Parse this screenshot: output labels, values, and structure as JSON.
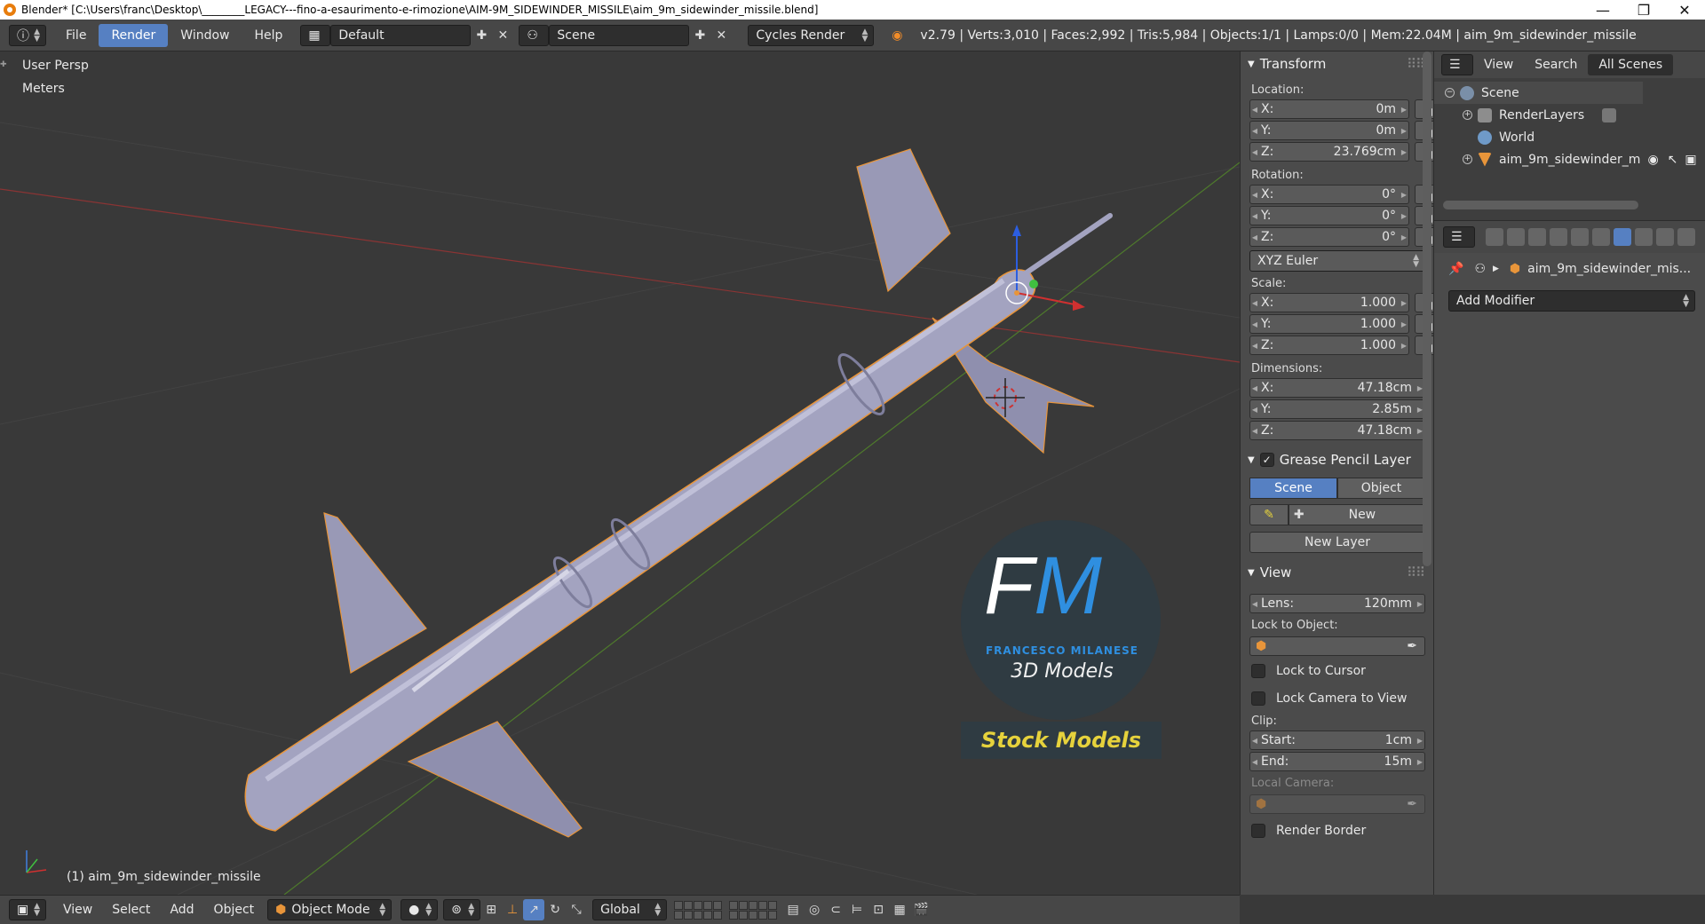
{
  "window": {
    "title": "Blender* [C:\\Users\\franc\\Desktop\\________LEGACY---fino-a-esaurimento-e-rimozione\\AIM-9M_SIDEWINDER_MISSILE\\aim_9m_sidewinder_missile.blend]",
    "minimize": "—",
    "maximize": "❐",
    "close": "✕"
  },
  "menubar": {
    "info_icon": "ⓘ",
    "file": "File",
    "render": "Render",
    "window": "Window",
    "help": "Help",
    "layout": "Default",
    "scene": "Scene",
    "engine": "Cycles Render",
    "stats": "v2.79 | Verts:3,010 | Faces:2,992 | Tris:5,984 | Objects:1/1 | Lamps:0/0 | Mem:22.04M | aim_9m_sidewinder_missile"
  },
  "viewport": {
    "view_name": "User Persp",
    "units": "Meters",
    "active_object": "(1) aim_9m_sidewinder_missile",
    "watermark": {
      "initials_f": "F",
      "initials_m": "M",
      "author": "FRANCESCO MILANESE",
      "tagline": "3D Models",
      "banner": "Stock Models"
    }
  },
  "transform": {
    "title": "Transform",
    "location_label": "Location:",
    "location": [
      {
        "axis": "X:",
        "value": "0m"
      },
      {
        "axis": "Y:",
        "value": "0m"
      },
      {
        "axis": "Z:",
        "value": "23.769cm"
      }
    ],
    "rotation_label": "Rotation:",
    "rotation": [
      {
        "axis": "X:",
        "value": "0°"
      },
      {
        "axis": "Y:",
        "value": "0°"
      },
      {
        "axis": "Z:",
        "value": "0°"
      }
    ],
    "rotation_mode": "XYZ Euler",
    "scale_label": "Scale:",
    "scale": [
      {
        "axis": "X:",
        "value": "1.000"
      },
      {
        "axis": "Y:",
        "value": "1.000"
      },
      {
        "axis": "Z:",
        "value": "1.000"
      }
    ],
    "dimensions_label": "Dimensions:",
    "dimensions": [
      {
        "axis": "X:",
        "value": "47.18cm"
      },
      {
        "axis": "Y:",
        "value": "2.85m"
      },
      {
        "axis": "Z:",
        "value": "47.18cm"
      }
    ]
  },
  "grease_pencil": {
    "title": "Grease Pencil Layer",
    "scene_tab": "Scene",
    "object_tab": "Object",
    "new_label": "New",
    "new_layer_label": "New Layer"
  },
  "view_panel": {
    "title": "View",
    "lens_label": "Lens:",
    "lens_value": "120mm",
    "lock_object_label": "Lock to Object:",
    "lock_cursor": "Lock to Cursor",
    "lock_camera": "Lock Camera to View",
    "clip_label": "Clip:",
    "clip_start_label": "Start:",
    "clip_start_value": "1cm",
    "clip_end_label": "End:",
    "clip_end_value": "15m",
    "local_camera_label": "Local Camera:",
    "render_border": "Render Border"
  },
  "outliner": {
    "view": "View",
    "search": "Search",
    "scenes": "All Scenes",
    "items": [
      {
        "label": "Scene"
      },
      {
        "label": "RenderLayers"
      },
      {
        "label": "World"
      },
      {
        "label": "aim_9m_sidewinder_m"
      }
    ]
  },
  "properties": {
    "object_name": "aim_9m_sidewinder_mis...",
    "add_modifier": "Add Modifier"
  },
  "bottombar": {
    "view": "View",
    "select": "Select",
    "add": "Add",
    "object": "Object",
    "mode": "Object Mode",
    "orientation": "Global"
  },
  "colors": {
    "accent": "#5680c2",
    "missile": "#9a9ab8",
    "selection_outline": "#e8953a",
    "grid_red": "#a33030",
    "grid_green": "#5a8a30",
    "logo_blue": "#2f8fe0",
    "logo_gold": "#e6d23c"
  }
}
